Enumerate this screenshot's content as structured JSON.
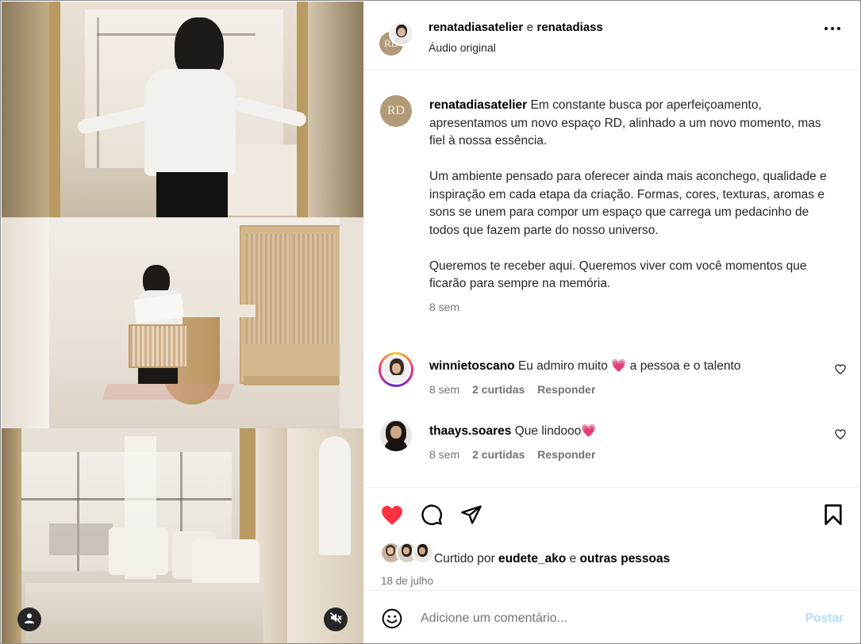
{
  "header": {
    "author": "renatadiasatelier",
    "connector": "e",
    "coauthor": "renatadiass",
    "audio": "Áudio original",
    "avatar_monogram": "RD"
  },
  "caption": {
    "username": "renatadiasatelier",
    "paragraphs": [
      "Em constante busca por aperfeiçoamento, apresentamos um novo espaço RD, alinhado a um novo momento, mas fiel à nossa essência.",
      "Um ambiente pensado para oferecer ainda mais aconchego, qualidade e inspiração em cada etapa da criação. Formas, cores, texturas, aromas e sons se unem para compor um espaço que carrega um pedacinho de todos que fazem parte do nosso universo.",
      "Queremos te receber aqui. Queremos viver com você momentos que ficarão para sempre na memória."
    ],
    "time": "8 sem"
  },
  "comments": [
    {
      "username": "winnietoscano",
      "text_before": "Eu admiro muito",
      "emoji": "💗",
      "text_after": "a pessoa e o talento",
      "time": "8 sem",
      "likes": "2 curtidas",
      "reply": "Responder"
    },
    {
      "username": "thaays.soares",
      "text_before": "Que lindooo",
      "emoji": "💗",
      "text_after": "",
      "time": "8 sem",
      "likes": "2 curtidas",
      "reply": "Responder"
    }
  ],
  "likes": {
    "prefix": "Curtido por",
    "user": "eudete_ako",
    "connector": "e",
    "others": "outras pessoas"
  },
  "date": "18 de julho",
  "composer": {
    "placeholder": "Adicione um comentário...",
    "post_label": "Postar"
  },
  "colors": {
    "like_red": "#ff3040",
    "post_disabled": "#b3dbff",
    "muted_text": "#737373",
    "rd_gold": "#b09a78"
  },
  "icons": [
    "heart-icon",
    "comment-icon",
    "share-icon",
    "bookmark-icon",
    "more-icon",
    "emoji-icon",
    "user-tag-icon",
    "muted-icon"
  ]
}
